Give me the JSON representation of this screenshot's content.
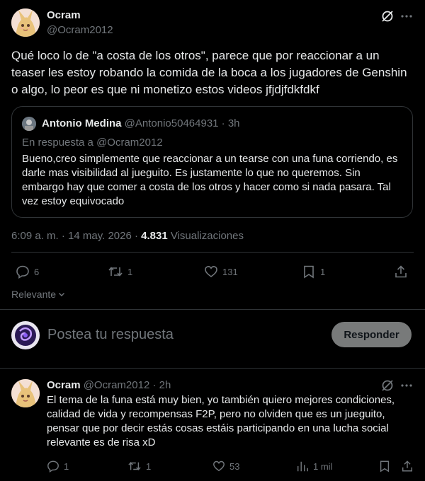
{
  "main_tweet": {
    "author_name": "Ocram",
    "author_handle": "@Ocram2012",
    "text": "Qué loco lo de \"a costa de los otros\", parece que por reaccionar a un teaser les estoy robando la comida de la boca a los jugadores de Genshin o algo, lo peor es que ni monetizo estos videos jfjdjfdkfdkf",
    "timestamp": "6:09 a. m. · 14 may. 2026 · ",
    "views_count": "4.831",
    "views_label": " Visualizaciones",
    "replies": "6",
    "retweets": "1",
    "likes": "131",
    "bookmarks": "1"
  },
  "quote": {
    "author_name": "Antonio Medina",
    "author_handle": "@Antonio50464931 · 3h",
    "reply_to": "En respuesta a @Ocram2012",
    "text": "Bueno,creo simplemente que reaccionar a un tearse  con una funa corriendo,  es  darle mas visibilidad al jueguito. Es justamente lo que no queremos. Sin embargo hay que comer a costa de los otros y hacer como si nada pasara.  Tal vez estoy equivocado"
  },
  "sort": {
    "label": "Relevante"
  },
  "composer": {
    "placeholder": "Postea tu respuesta",
    "button_label": "Responder"
  },
  "reply_tweet": {
    "author_name": "Ocram",
    "author_handle": "@Ocram2012 · 2h",
    "text": "El tema de la funa está muy bien, yo también quiero mejores condiciones, calidad de vida y recompensas F2P, pero no olviden que es un jueguito, pensar que por decir estás cosas estáis participando en una lucha social relevante es de risa xD",
    "replies": "1",
    "retweets": "1",
    "likes": "53",
    "views": "1 mil"
  },
  "colors": {
    "background": "#000000",
    "text": "#e7e9ea",
    "muted": "#71767b",
    "border": "#2f3336",
    "button": "#787a7a"
  }
}
